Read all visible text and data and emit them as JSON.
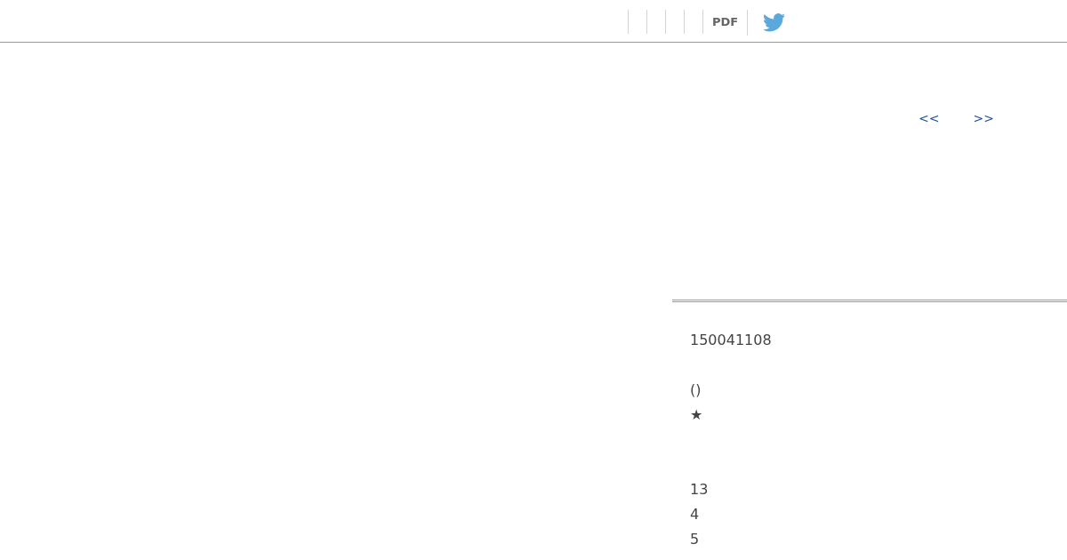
{
  "toolbar": {
    "pdf_link": "PDF"
  },
  "pager": {
    "previous": "<<",
    "next": ">>"
  },
  "details": {
    "sections": [
      {
        "lines": [
          "150041108"
        ]
      },
      {
        "lines": [
          "()",
          "★"
        ]
      },
      {
        "lines": [
          "13",
          "4",
          "5"
        ]
      }
    ]
  }
}
